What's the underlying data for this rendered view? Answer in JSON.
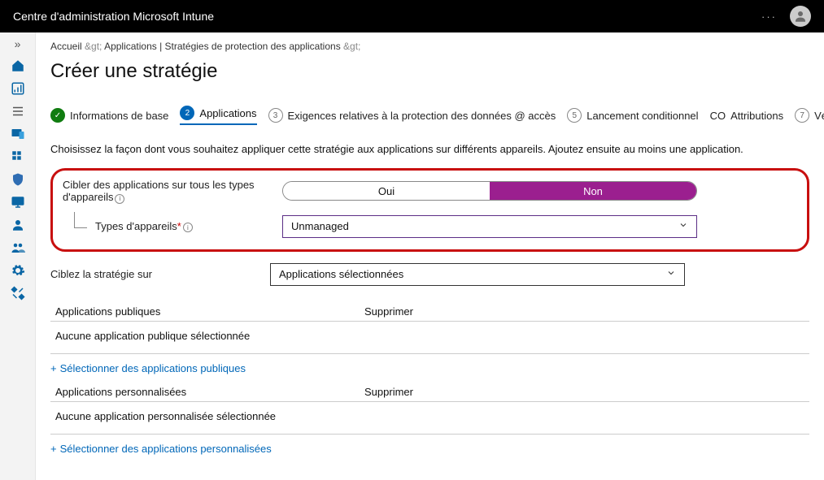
{
  "topbar": {
    "title": "Centre d'administration Microsoft Intune",
    "ellipsis": "···"
  },
  "breadcrumb": {
    "home": "Accueil",
    "gt": ">",
    "apps": "Applications | Stratégies de protection des applications",
    "gt2": ">"
  },
  "pageTitle": "Créer une stratégie",
  "wizard": {
    "step1": "Informations de base",
    "step2num": "2",
    "step2": "Applications",
    "step3num": "3",
    "step3": "Exigences relatives à la protection des données @ accès",
    "step5num": "5",
    "step5": "Lancement conditionnel",
    "step6num": "CO",
    "step6": "Attributions",
    "step7num": "7",
    "step7": "Vérifier + créer"
  },
  "intro": "Choisissez la façon dont vous souhaitez appliquer cette stratégie aux applications sur différents appareils. Ajoutez ensuite au moins une application.",
  "form": {
    "targetAllLabel": "Cibler des applications sur tous les types d'appareils",
    "yes": "Oui",
    "no": "Non",
    "deviceTypesLabel": "Types d'appareils",
    "deviceTypesValue": "Unmanaged",
    "targetPolicyLabel": "Ciblez la stratégie sur",
    "targetPolicyValue": "Applications sélectionnées"
  },
  "publicApps": {
    "header": "Applications publiques",
    "removeHeader": "Supprimer",
    "empty": "Aucune application publique sélectionnée",
    "addLink": "Sélectionner des applications publiques"
  },
  "customApps": {
    "header": "Applications personnalisées",
    "removeHeader": "Supprimer",
    "empty": "Aucune application personnalisée sélectionnée",
    "addLink": "Sélectionner des applications personnalisées"
  }
}
